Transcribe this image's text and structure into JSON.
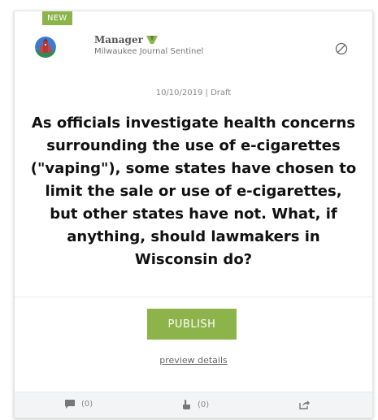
{
  "badge": {
    "label": "NEW"
  },
  "author": {
    "name": "Manager",
    "organization": "Milwaukee Journal Sentinel"
  },
  "meta": {
    "text": "10/10/2019 | Draft"
  },
  "question": {
    "text": "As officials investigate health concerns surrounding the use of e-cigarettes (\"vaping\"), some states have chosen to limit the sale or use of e-cigarettes, but other states have not. What, if anything, should lawmakers in Wisconsin do?"
  },
  "actions": {
    "publish_label": "PUBLISH",
    "preview_label": "preview details"
  },
  "footer": {
    "comments_count": "(0)",
    "votes_count": "(0)"
  },
  "icons": {
    "avatar": "building-avatar-icon",
    "verified": "green-publisher-mark-icon",
    "block": "prohibited-icon",
    "comments": "comment-icon",
    "votes": "hand-pointer-icon",
    "share": "share-icon"
  },
  "colors": {
    "accent": "#8cb44a",
    "footer_bg": "#f3f4f5",
    "text_dark": "#111111"
  }
}
